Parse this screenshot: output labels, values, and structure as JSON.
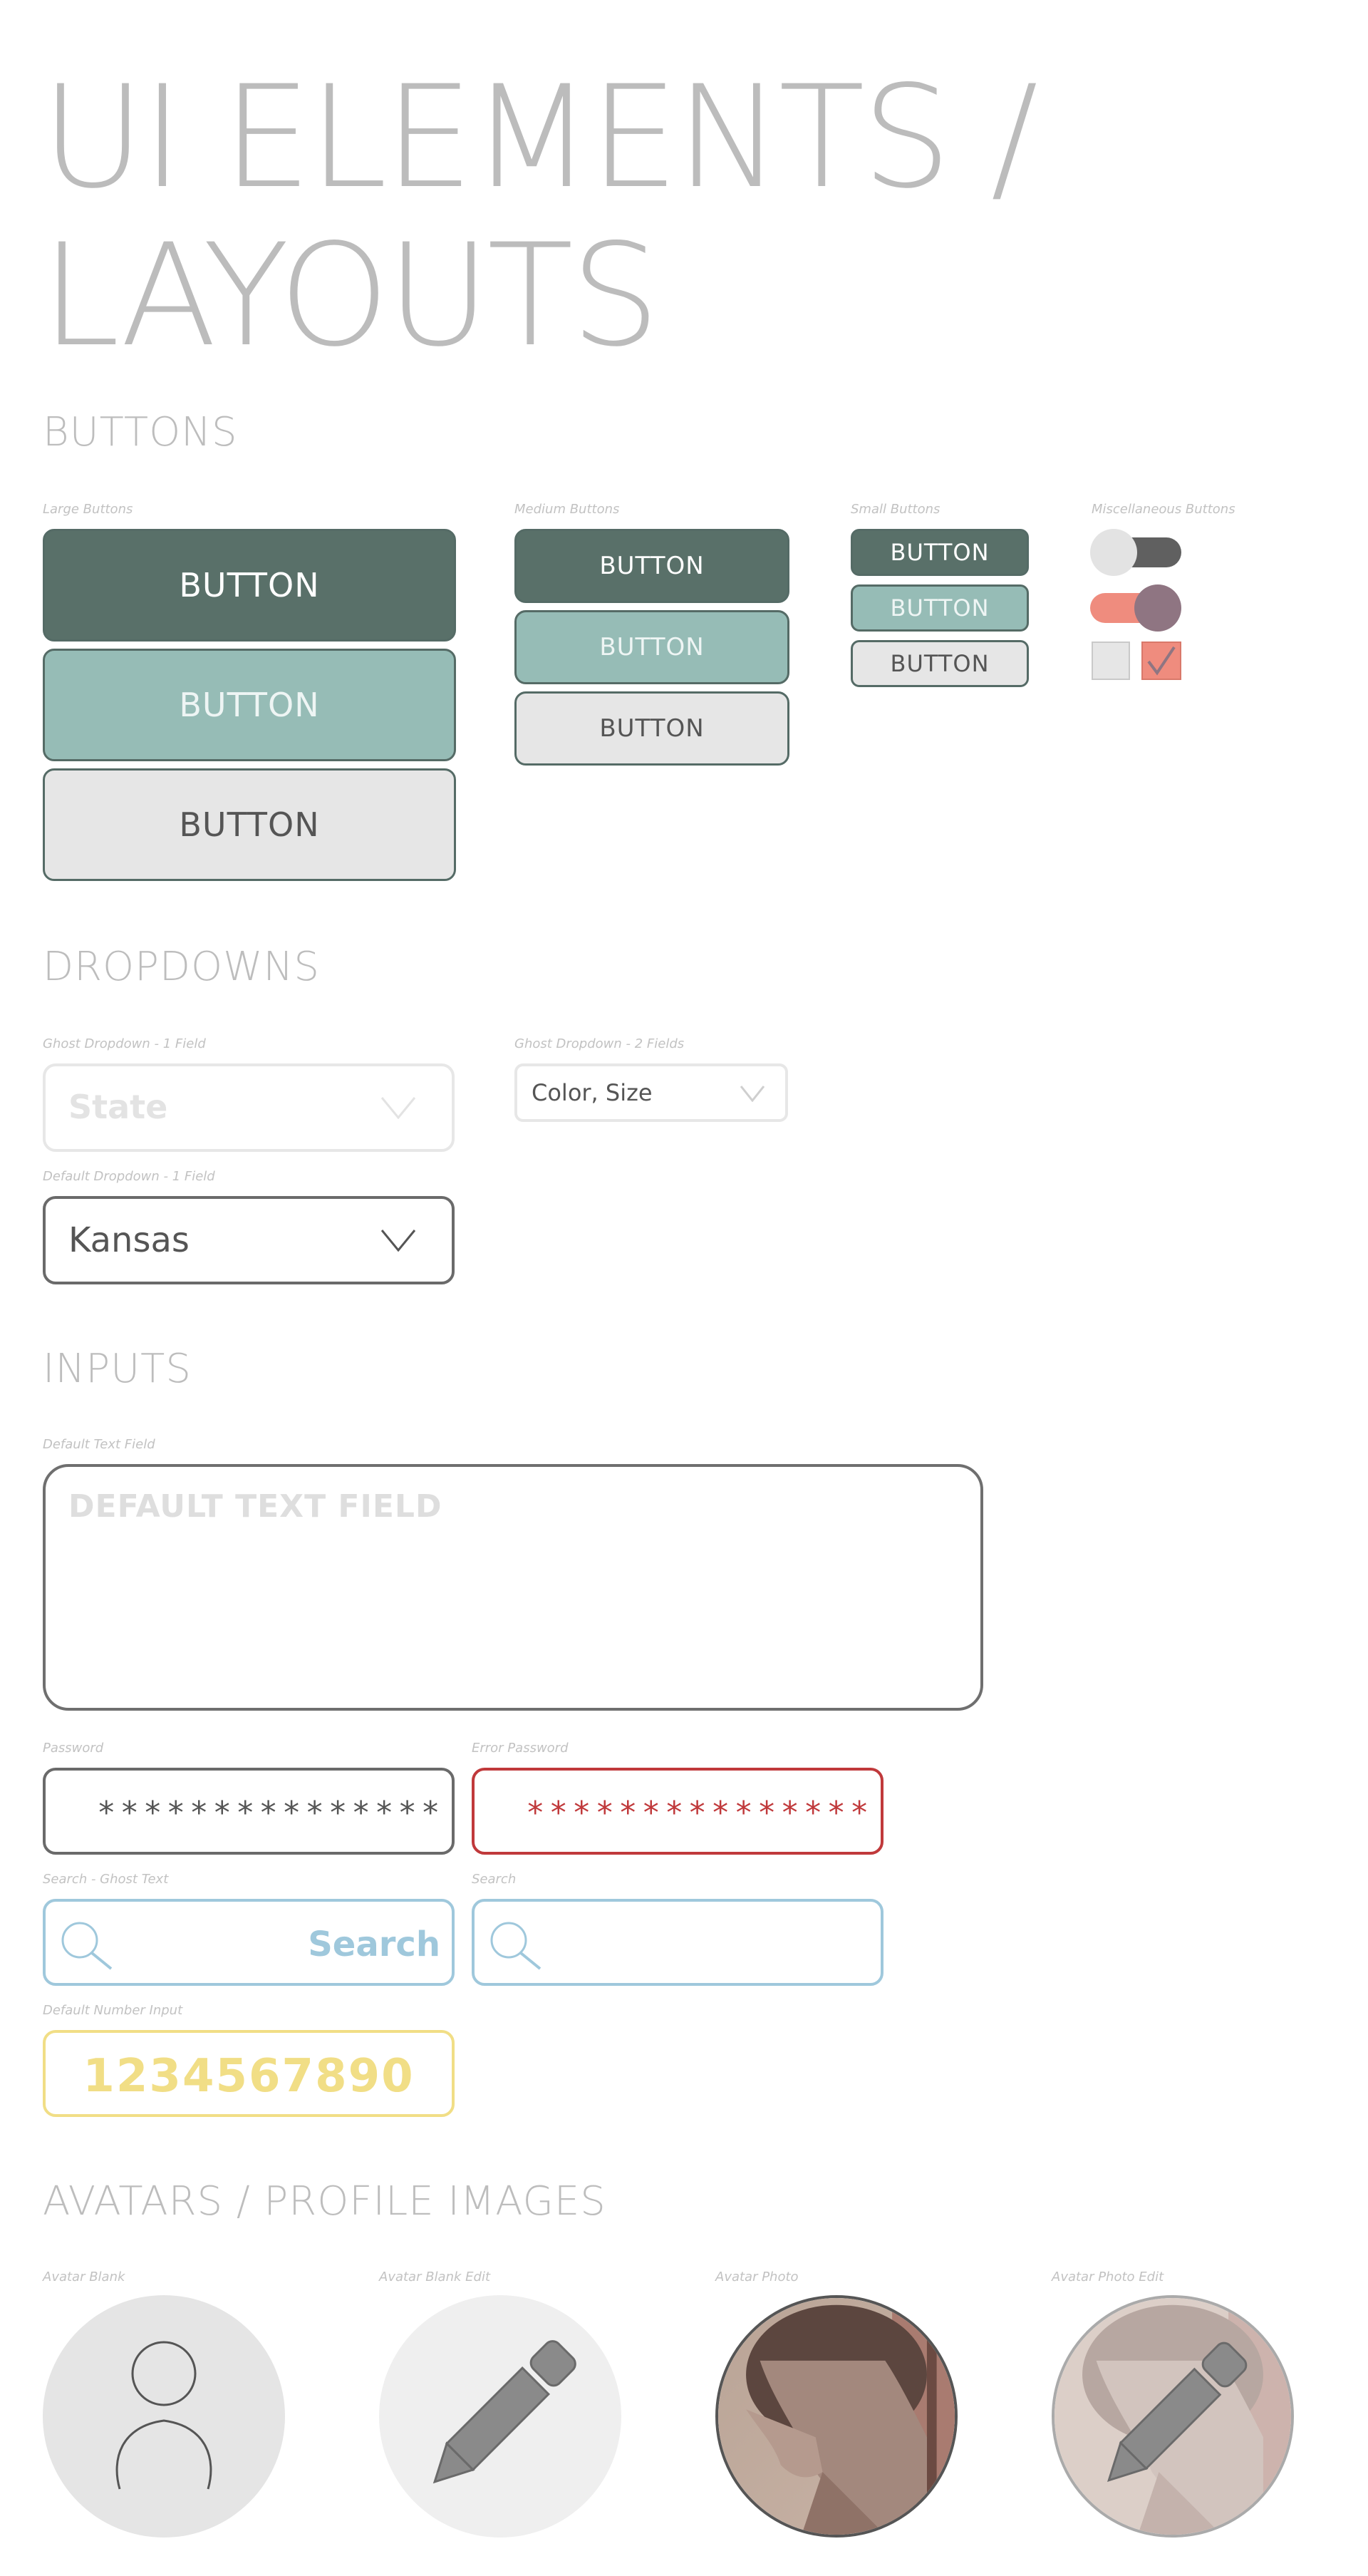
{
  "page_title": "UI ELEMENTS / LAYOUTS",
  "sections": {
    "buttons": "BUTTONS",
    "dropdowns": "DROPDOWNS",
    "inputs": "INPUTS",
    "avatars": "AVATARS / PROFILE IMAGES"
  },
  "buttons": {
    "large_caption": "Large Buttons",
    "medium_caption": "Medium Buttons",
    "small_caption": "Small Buttons",
    "misc_caption": "Miscellaneous Buttons",
    "label": "BUTTON",
    "toggle_off": false,
    "toggle_on": true,
    "checkbox_unchecked": false,
    "checkbox_checked": true
  },
  "dropdowns": {
    "ghost1_caption": "Ghost Dropdown - 1 Field",
    "ghost1_placeholder": "State",
    "ghost2_caption": "Ghost Dropdown - 2 Fields",
    "ghost2_value": "Color, Size",
    "default_caption": "Default Dropdown - 1 Field",
    "default_value": "Kansas"
  },
  "inputs": {
    "textfield_caption": "Default Text Field",
    "textfield_placeholder": "DEFAULT TEXT FIELD",
    "password_caption": "Password",
    "password_mask": "***************",
    "error_password_caption": "Error Password",
    "error_password_mask": "***************",
    "search_ghost_caption": "Search - Ghost Text",
    "search_ghost_text": "Search",
    "search_caption": "Search",
    "number_caption": "Default Number Input",
    "number_value": "1234567890"
  },
  "avatars": {
    "blank_caption": "Avatar Blank",
    "blank_edit_caption": "Avatar Blank Edit",
    "photo_caption": "Avatar Photo",
    "photo_edit_caption": "Avatar Photo Edit"
  },
  "colors": {
    "dark_green": "#597069",
    "teal": "#96bcb6",
    "light_gray": "#e6e6e6",
    "salmon": "#ef8c7e",
    "mauve": "#8f7582",
    "error_red": "#c0393b",
    "search_blue": "#9fc8dc",
    "number_yellow": "#f1de86"
  },
  "icons": {
    "dropdown": "chevron-down-icon",
    "search": "search-icon",
    "checkbox": "check-icon",
    "avatar_blank": "user-icon",
    "avatar_edit": "pencil-icon"
  }
}
